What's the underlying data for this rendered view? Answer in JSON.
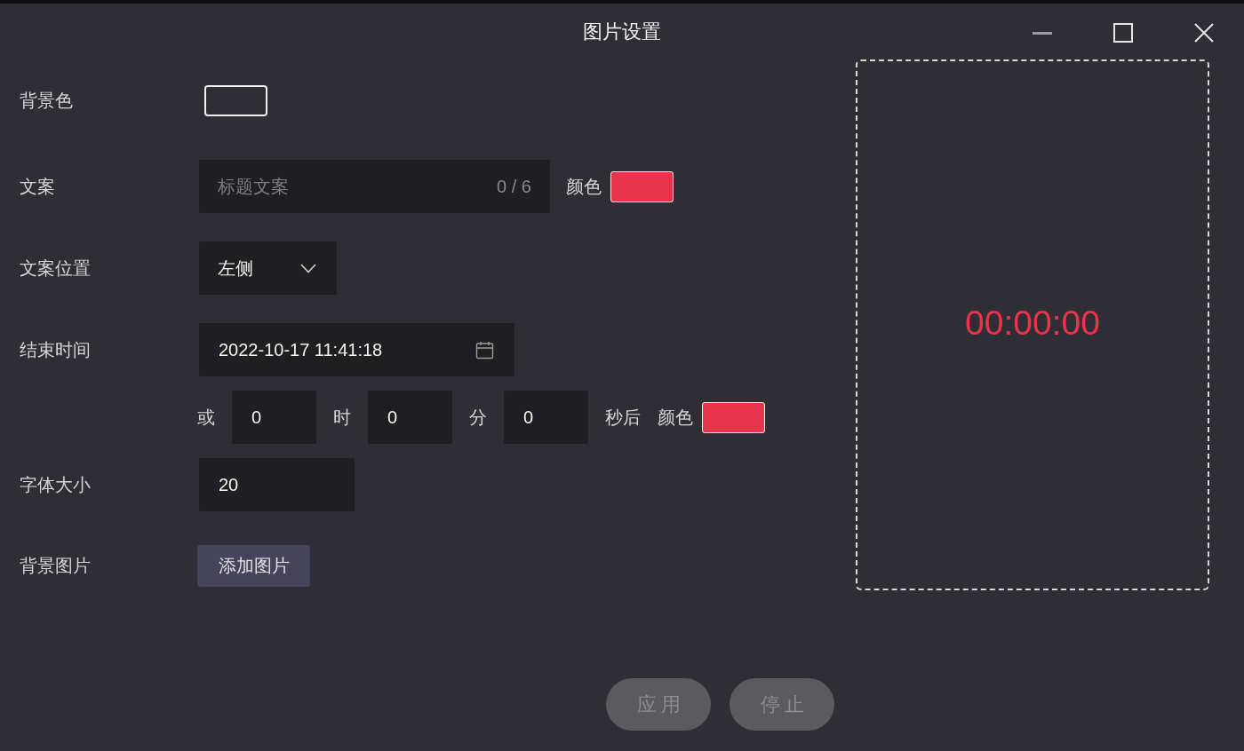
{
  "window": {
    "title": "图片设置"
  },
  "form": {
    "background_color": {
      "label": "背景色",
      "color": "#2f2e35"
    },
    "caption": {
      "label": "文案",
      "placeholder": "标题文案",
      "counter": "0 / 6",
      "color_label": "颜色",
      "color": "#e8334a"
    },
    "caption_position": {
      "label": "文案位置",
      "value": "左侧"
    },
    "end_time": {
      "label": "结束时间",
      "value": "2022-10-17 11:41:18"
    },
    "countdown": {
      "prefix": "或",
      "fields": [
        {
          "value": "0",
          "unit": "时"
        },
        {
          "value": "0",
          "unit": "分"
        },
        {
          "value": "0",
          "unit": "秒后"
        }
      ],
      "color_label": "颜色",
      "color": "#e8334a"
    },
    "font_size": {
      "label": "字体大小",
      "value": "20"
    },
    "background_image": {
      "label": "背景图片",
      "button": "添加图片"
    }
  },
  "preview": {
    "timer": "00:00:00"
  },
  "buttons": [
    {
      "label": "应用",
      "disabled": true
    },
    {
      "label": "停止",
      "disabled": true
    }
  ]
}
